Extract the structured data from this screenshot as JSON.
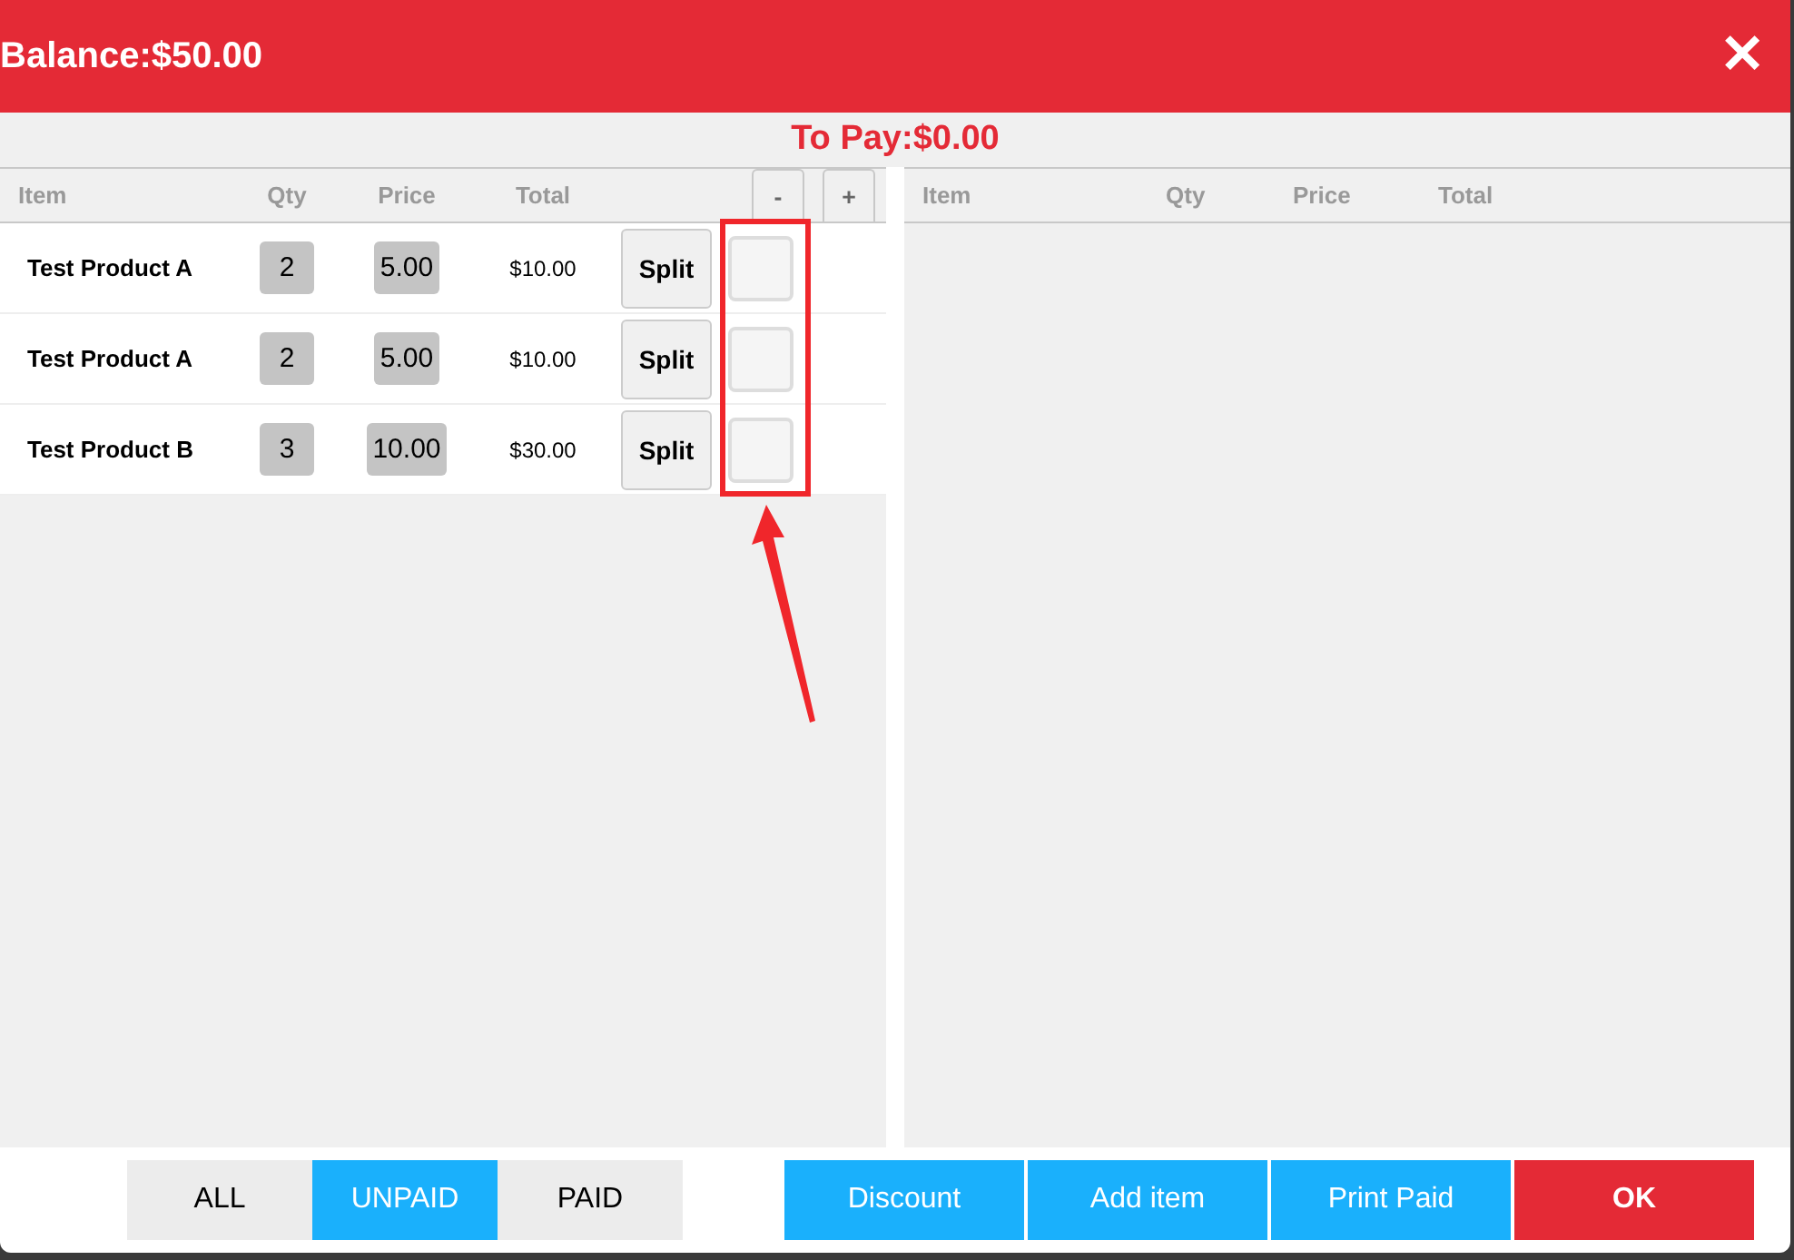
{
  "header": {
    "title": "Balance:$50.00",
    "close": "✕"
  },
  "to_pay": "To Pay:$0.00",
  "left_table": {
    "columns": [
      "Item",
      "Qty",
      "Price",
      "Total"
    ],
    "minus": "-",
    "plus": "+",
    "rows": [
      {
        "item": "Test Product A",
        "qty": "2",
        "price": "5.00",
        "total": "$10.00",
        "split": "Split",
        "checked": false
      },
      {
        "item": "Test Product A",
        "qty": "2",
        "price": "5.00",
        "total": "$10.00",
        "split": "Split",
        "checked": false
      },
      {
        "item": "Test Product B",
        "qty": "3",
        "price": "10.00",
        "total": "$30.00",
        "split": "Split",
        "checked": false
      }
    ]
  },
  "right_table": {
    "columns": [
      "Item",
      "Qty",
      "Price",
      "Total"
    ]
  },
  "filters": [
    {
      "label": "ALL",
      "selected": false
    },
    {
      "label": "UNPAID",
      "selected": true
    },
    {
      "label": "PAID",
      "selected": false
    }
  ],
  "actions": [
    {
      "label": "Discount",
      "kind": "secondary"
    },
    {
      "label": "Add item",
      "kind": "secondary"
    },
    {
      "label": "Print Paid",
      "kind": "secondary"
    },
    {
      "label": "OK",
      "kind": "primary"
    }
  ]
}
